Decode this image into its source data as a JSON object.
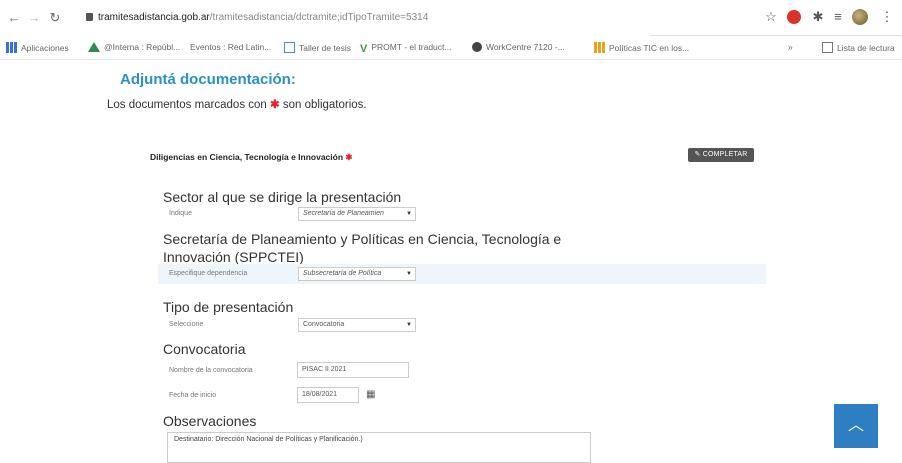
{
  "browser": {
    "url_host": "tramitesadistancia.gob.ar",
    "url_path": "/tramitesadistancia/dctramite;idTipoTramite=5314",
    "bookmarks": [
      {
        "icon": "apps-grid-icon",
        "label": "Aplicaciones"
      },
      {
        "icon": "drive-icon",
        "label": "@Interna : Repúbl..."
      },
      {
        "icon": "",
        "label": "Eventos : Red Latin..."
      },
      {
        "icon": "square-icon",
        "label": "Taller de tesis"
      },
      {
        "icon": "v-icon",
        "label": "PROMT - el traduct..."
      },
      {
        "icon": "globe-icon",
        "label": "WorkCentre 7120 -..."
      },
      {
        "icon": "chart-icon",
        "label": "Políticas TIC en los..."
      }
    ],
    "reading_list_label": "Lista de lectura"
  },
  "page": {
    "heading": "Adjuntá documentación:",
    "notice_before": "Los documentos marcados con",
    "notice_after": "son obligatorios.",
    "required_mark": "✱"
  },
  "section": {
    "title": "Diligencias en Ciencia, Tecnología e Innovación",
    "complete_button": "COMPLETAR"
  },
  "form": {
    "sector": {
      "heading": "Sector al que se dirige la presentación",
      "label": "Indique",
      "value": "Secretaría de Planeamien"
    },
    "secretaria": {
      "heading": "Secretaría de Planeamiento y Políticas en Ciencia, Tecnología e Innovación (SPPCTEI)",
      "label": "Especifique dependencia",
      "value": "Subsecretaría de Política"
    },
    "tipo": {
      "heading": "Tipo de presentación",
      "label": "Seleccione",
      "value": "Convocatoria"
    },
    "convocatoria": {
      "heading": "Convocatoria",
      "name_label": "Nombre de la convocatoria",
      "name_value": "PISAC II 2021",
      "date_label": "Fecha de inicio",
      "date_value": "18/08/2021"
    },
    "observaciones": {
      "heading": "Observaciones",
      "value": "Destinatario: Dirección Nacional de Políticas y Planificación.)"
    }
  },
  "colors": {
    "heading": "#2a90c8",
    "required": "#e0252b",
    "fab": "#2d7fc1"
  }
}
